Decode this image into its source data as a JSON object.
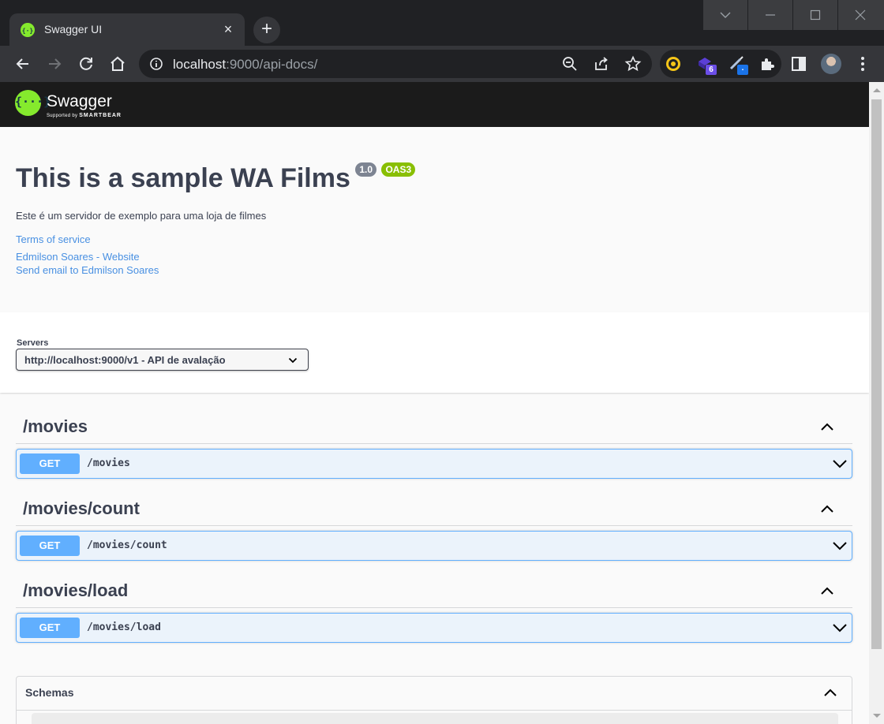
{
  "browser": {
    "tab_title": "Swagger UI",
    "tab_close": "×",
    "new_tab": "+",
    "url_host": "localhost",
    "url_rest": ":9000/api-docs/",
    "extension_badges": [
      "6",
      "."
    ]
  },
  "swagger": {
    "logo_symbol": "{···}",
    "logo_name": "Swagger",
    "logo_sub_prefix": "Supported by",
    "logo_sub_brand": "SMARTBEAR"
  },
  "info": {
    "title": "This is a sample WA Films",
    "version": "1.0",
    "oas": "OAS3",
    "description": "Este é um servidor de exemplo para uma loja de filmes",
    "terms_link": "Terms of service",
    "website_link": "Edmilson Soares - Website",
    "email_link": "Send email to Edmilson Soares"
  },
  "servers": {
    "label": "Servers",
    "selected": "http://localhost:9000/v1 - API de avalação"
  },
  "tags": [
    {
      "name": "/movies",
      "operations": [
        {
          "method": "GET",
          "path": "/movies"
        }
      ]
    },
    {
      "name": "/movies/count",
      "operations": [
        {
          "method": "GET",
          "path": "/movies/count"
        }
      ]
    },
    {
      "name": "/movies/load",
      "operations": [
        {
          "method": "GET",
          "path": "/movies/load"
        }
      ]
    }
  ],
  "schemas": {
    "title": "Schemas"
  },
  "colors": {
    "get": "#61affe",
    "get_bg": "#ebf3fb",
    "swagger_green": "#85ea2d",
    "link": "#4990e2",
    "text": "#3b4151"
  }
}
